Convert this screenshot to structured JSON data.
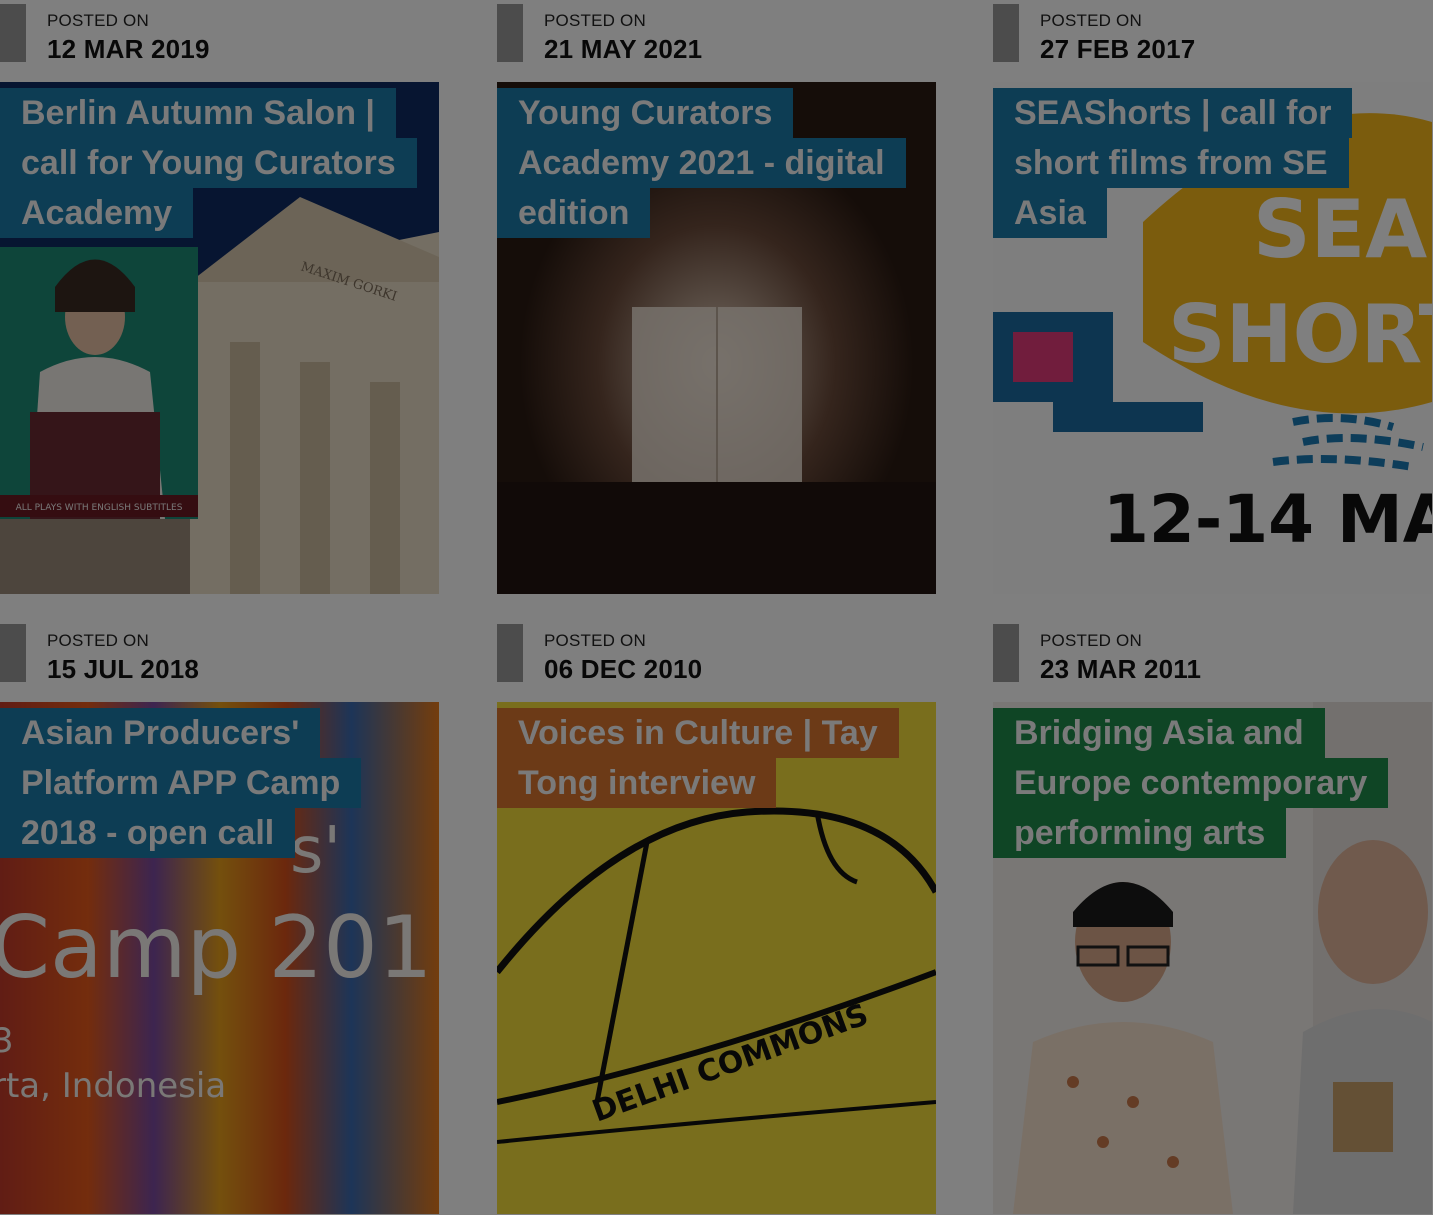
{
  "cards": [
    {
      "posted_label": "POSTED ON",
      "date": "12 MAR 2019",
      "title_lines": [
        "Berlin Autumn Salon |",
        "call for Young Curators",
        "Academy"
      ],
      "title_color": "#1a7aa8",
      "image_text": [
        "MAXIM GORKI",
        "ALL PLAYS WITH ENGLISH SUBTITLES"
      ]
    },
    {
      "posted_label": "POSTED ON",
      "date": "21 MAY 2021",
      "title_lines": [
        "Young Curators",
        "Academy 2021 - digital",
        "edition"
      ],
      "title_color": "#1a7aa8"
    },
    {
      "posted_label": "POSTED ON",
      "date": "27 FEB 2017",
      "title_lines": [
        "SEAShorts | call for",
        "short films from SE",
        "Asia"
      ],
      "title_color": "#1a7aa8",
      "image_text": [
        "SEA",
        "SHORT",
        "12-14 MA"
      ]
    },
    {
      "posted_label": "POSTED ON",
      "date": "15 JUL 2018",
      "title_lines": [
        "Asian Producers'",
        "Platform APP Camp",
        "2018 - open call"
      ],
      "title_color": "#1a7aa8",
      "image_text": [
        "s'",
        "Camp 201",
        "3",
        "rta, Indonesia"
      ]
    },
    {
      "posted_label": "POSTED ON",
      "date": "06 DEC 2010",
      "title_lines": [
        "Voices in Culture | Tay",
        "Tong interview"
      ],
      "title_color": "#d8742f",
      "image_text": [
        "DELHI COMMONS"
      ]
    },
    {
      "posted_label": "POSTED ON",
      "date": "23 MAR 2011",
      "title_lines": [
        "Bridging Asia and",
        "Europe contemporary",
        "performing arts"
      ],
      "title_color": "#1f8a4a"
    }
  ]
}
